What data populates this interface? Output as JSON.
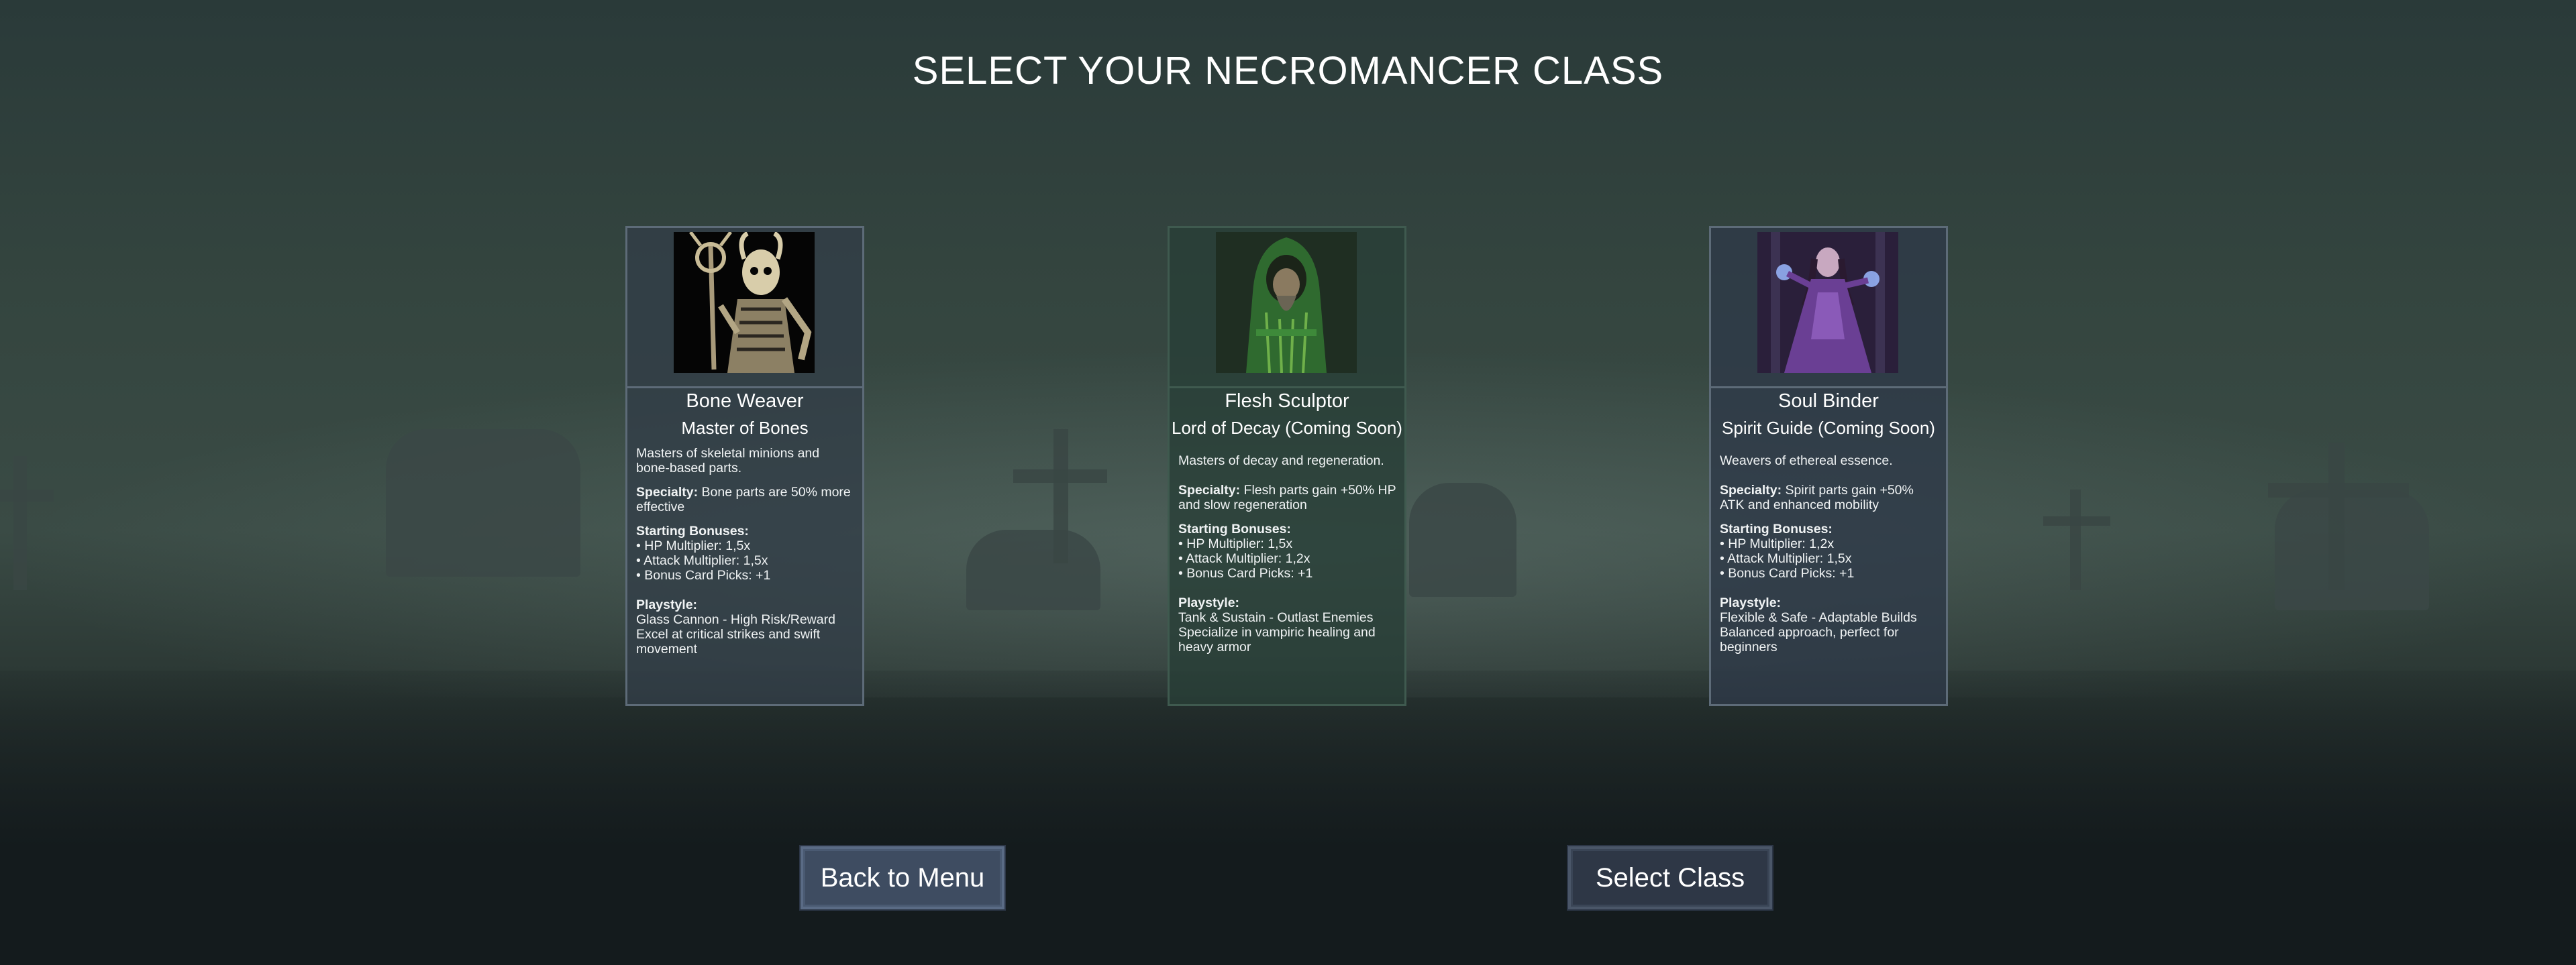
{
  "screen": {
    "title": "SELECT YOUR NECROMANCER CLASS"
  },
  "classes": [
    {
      "name": "Bone Weaver",
      "subtitle": "Master of Bones",
      "description": "Masters of skeletal minions and bone-based parts.",
      "specialty_label": "Specialty:",
      "specialty": "Bone parts are 50% more effective",
      "bonuses_label": "Starting Bonuses:",
      "bonuses": [
        "• HP Multiplier: 1,5x",
        "• Attack Multiplier: 1,5x",
        "• Bonus Card Picks: +1"
      ],
      "playstyle_label": "Playstyle:",
      "playstyle_title": "Glass Cannon - High Risk/Reward",
      "playstyle_desc": "Excel at critical strikes and swift movement",
      "portrait_icon": "skeleton-necromancer-portrait"
    },
    {
      "name": "Flesh Sculptor",
      "subtitle": "Lord of Decay (Coming Soon)",
      "description": "Masters of decay and regeneration.",
      "specialty_label": "Specialty:",
      "specialty": "Flesh parts gain +50% HP and slow regeneration",
      "bonuses_label": "Starting Bonuses:",
      "bonuses": [
        "• HP Multiplier: 1,5x",
        "• Attack Multiplier: 1,2x",
        "• Bonus Card Picks: +1"
      ],
      "playstyle_label": "Playstyle:",
      "playstyle_title": "Tank & Sustain - Outlast Enemies",
      "playstyle_desc": "Specialize in vampiric healing and heavy armor",
      "portrait_icon": "hooded-green-sorcerer-portrait"
    },
    {
      "name": "Soul Binder",
      "subtitle": "Spirit Guide (Coming Soon)",
      "description": "Weavers of ethereal essence.",
      "specialty_label": "Specialty:",
      "specialty": "Spirit parts gain +50% ATK and enhanced mobility",
      "bonuses_label": "Starting Bonuses:",
      "bonuses": [
        "• HP Multiplier: 1,2x",
        "• Attack Multiplier: 1,5x",
        "• Bonus Card Picks: +1"
      ],
      "playstyle_label": "Playstyle:",
      "playstyle_title": "Flexible & Safe - Adaptable Builds",
      "playstyle_desc": "Balanced approach, perfect for beginners",
      "portrait_icon": "purple-sorceress-portrait"
    }
  ],
  "buttons": {
    "back": "Back to Menu",
    "select": "Select Class"
  },
  "colors": {
    "background": "#34453f",
    "card_border": "#5d6b78",
    "button": "#3e4c61"
  }
}
